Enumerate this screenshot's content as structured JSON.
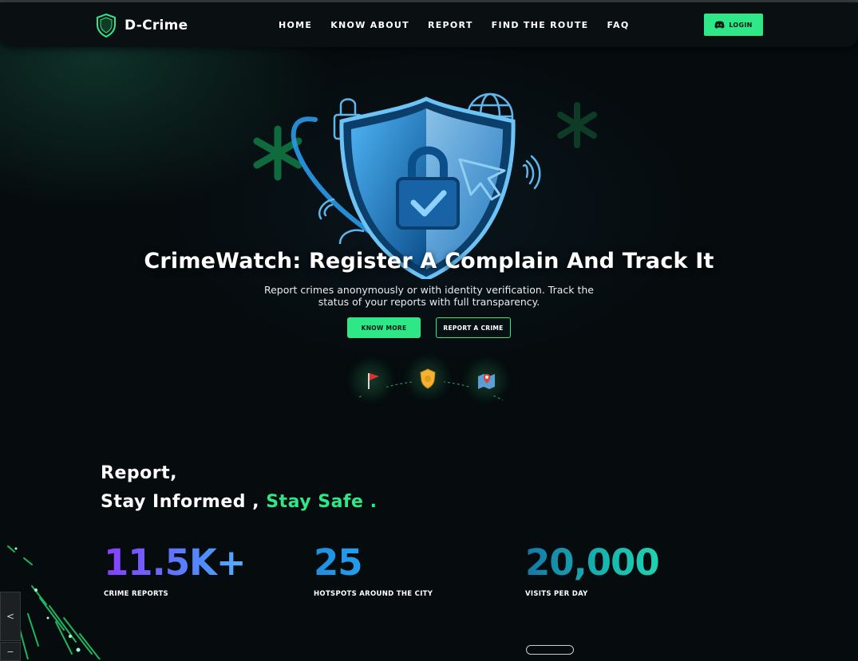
{
  "nav": {
    "brand": "D-Crime",
    "links": [
      "HOME",
      "KNOW ABOUT",
      "REPORT",
      "FIND THE ROUTE",
      "FAQ"
    ],
    "login_label": "LOGIN"
  },
  "hero": {
    "title": "CrimeWatch: Register A Complain And Track It",
    "subtitle": "Report crimes anonymously or with identity verification. Track the status of your reports with full transparency.",
    "primary_button": "KNOW MORE",
    "secondary_button": "REPORT A CRIME",
    "steps": [
      "flag-icon",
      "police-badge-icon",
      "map-pin-icon"
    ]
  },
  "tagline": {
    "line1": "Report,",
    "line2_white": "Stay Informed ,",
    "line2_green": "Stay Safe ."
  },
  "stats": [
    {
      "value": "11.5K+",
      "label": "CRIME REPORTS"
    },
    {
      "value": "25",
      "label": "HOTSPOTS AROUND THE CITY"
    },
    {
      "value": "20,000",
      "label": "VISITS PER DAY"
    }
  ],
  "side_tab": {
    "glyph": "<"
  },
  "colors": {
    "accent": "#2ee888",
    "background": "#060b0d",
    "shield": "#1f8fe0"
  }
}
